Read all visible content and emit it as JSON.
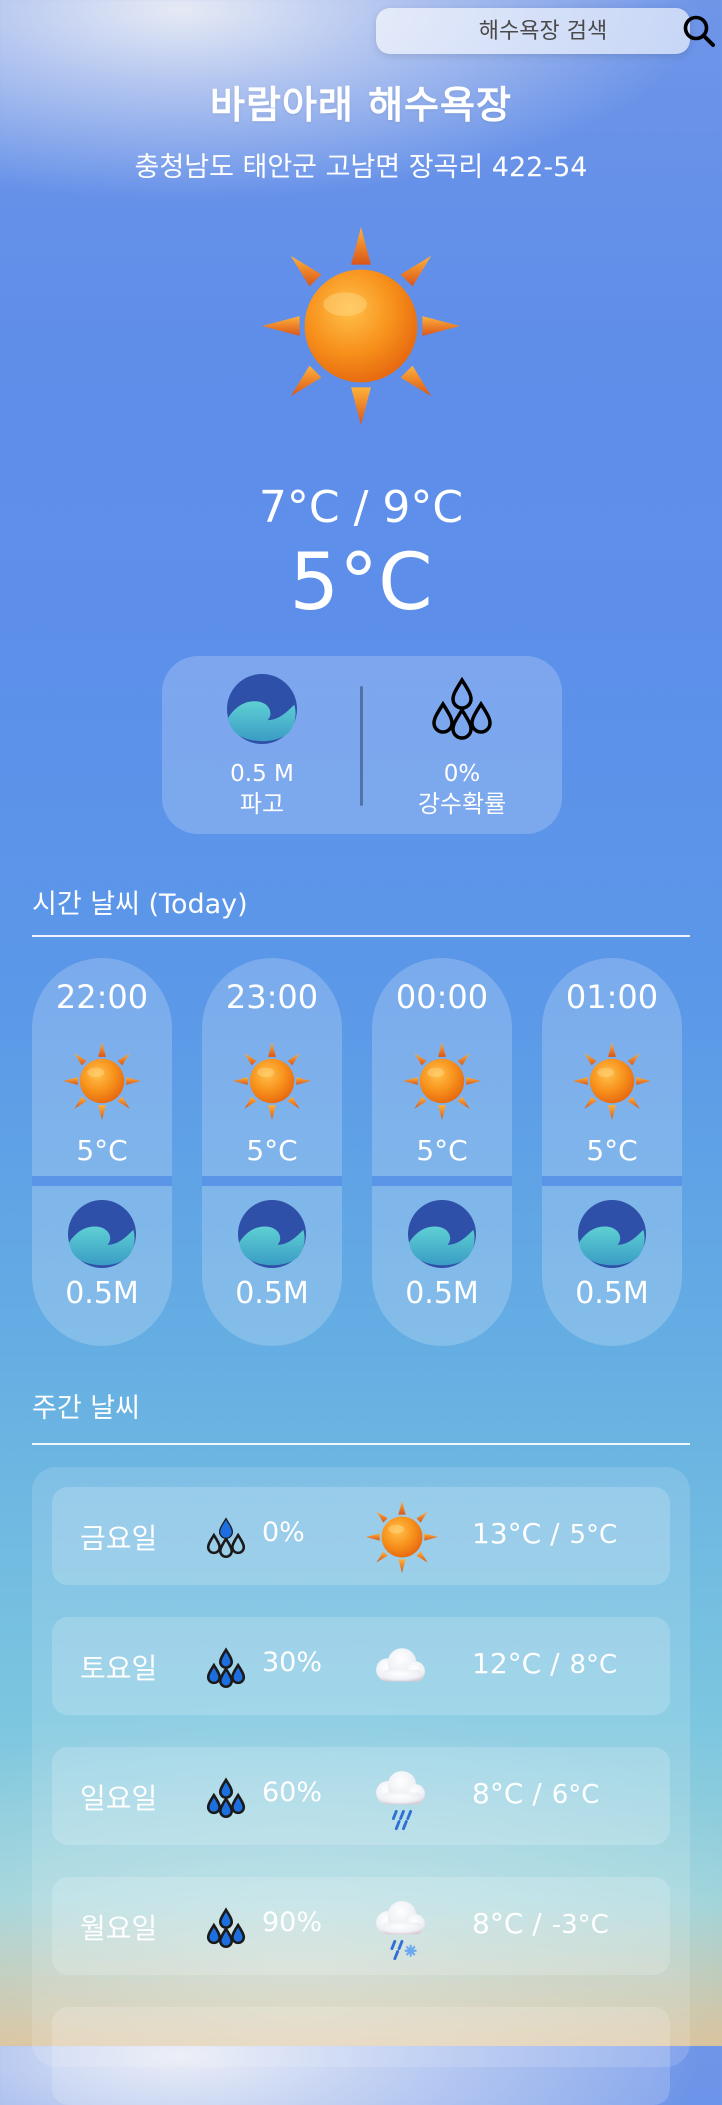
{
  "search": {
    "placeholder": "해수욕장 검색"
  },
  "beach": {
    "name": "바람아래 해수욕장",
    "address": "충청남도 태안군 고남면 장곡리 422-54"
  },
  "today": {
    "icon": "sun-icon",
    "temp_range": "7°C / 9°C",
    "current_temp": "5°C",
    "wave_height": "0.5 M",
    "wave_label": "파고",
    "rain_prob": "0%",
    "rain_label": "강수확률"
  },
  "hourly": {
    "title": "시간 날씨 (Today)",
    "items": [
      {
        "time": "22:00",
        "icon": "sun-icon",
        "temp": "5°C",
        "wave": "0.5M"
      },
      {
        "time": "23:00",
        "icon": "sun-icon",
        "temp": "5°C",
        "wave": "0.5M"
      },
      {
        "time": "00:00",
        "icon": "sun-icon",
        "temp": "5°C",
        "wave": "0.5M"
      },
      {
        "time": "01:00",
        "icon": "sun-icon",
        "temp": "5°C",
        "wave": "0.5M"
      }
    ]
  },
  "weekly": {
    "title": "주간 날씨",
    "items": [
      {
        "day": "금요일",
        "rain": "0%",
        "icon": "sun-icon",
        "high": "13°C /",
        "low": "5°C"
      },
      {
        "day": "토요일",
        "rain": "30%",
        "icon": "cloud-icon",
        "high": "12°C /",
        "low": "8°C"
      },
      {
        "day": "일요일",
        "rain": "60%",
        "icon": "rain-cloud-icon",
        "high": "8°C /",
        "low": "6°C"
      },
      {
        "day": "월요일",
        "rain": "90%",
        "icon": "snow-rain-cloud-icon",
        "high": "8°C /",
        "low": "-3°C"
      }
    ]
  },
  "colors": {
    "sun_core": "#f7911b",
    "sun_ray": "#e8661a",
    "wave_dark": "#2f50a8",
    "wave_light": "#4fb8c8",
    "drop_blue": "#1d4fd0"
  }
}
